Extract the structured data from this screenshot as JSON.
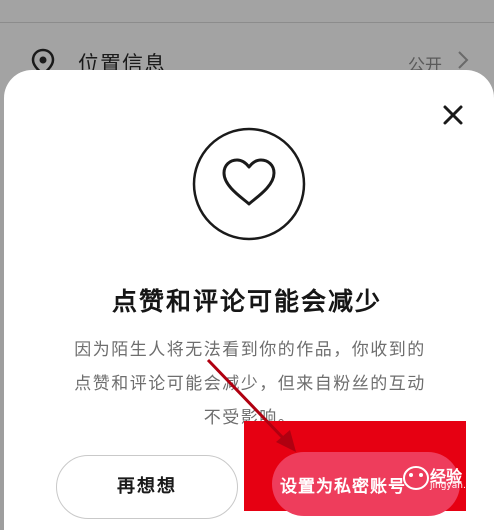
{
  "background_row": {
    "label": "位置信息",
    "value": "公开"
  },
  "dialog": {
    "title": "点赞和评论可能会减少",
    "description_lines": [
      "因为陌生人将无法看到你的作品，你收到的",
      "点赞和评论可能会减少，但来自粉丝的互动",
      "不受影响。"
    ],
    "cancel_label": "再想想",
    "confirm_label": "设置为私密账号"
  },
  "watermark": {
    "text": "经验",
    "sub": "jingyan.baidu.com"
  },
  "icons": {
    "location": "location-pin-icon",
    "chevron": "chevron-right-icon",
    "close": "close-icon",
    "heart": "heart-icon"
  },
  "colors": {
    "overlay": "#9e9e9e",
    "confirm_button": "#ee3d5c",
    "annotation_red": "#e60012"
  }
}
